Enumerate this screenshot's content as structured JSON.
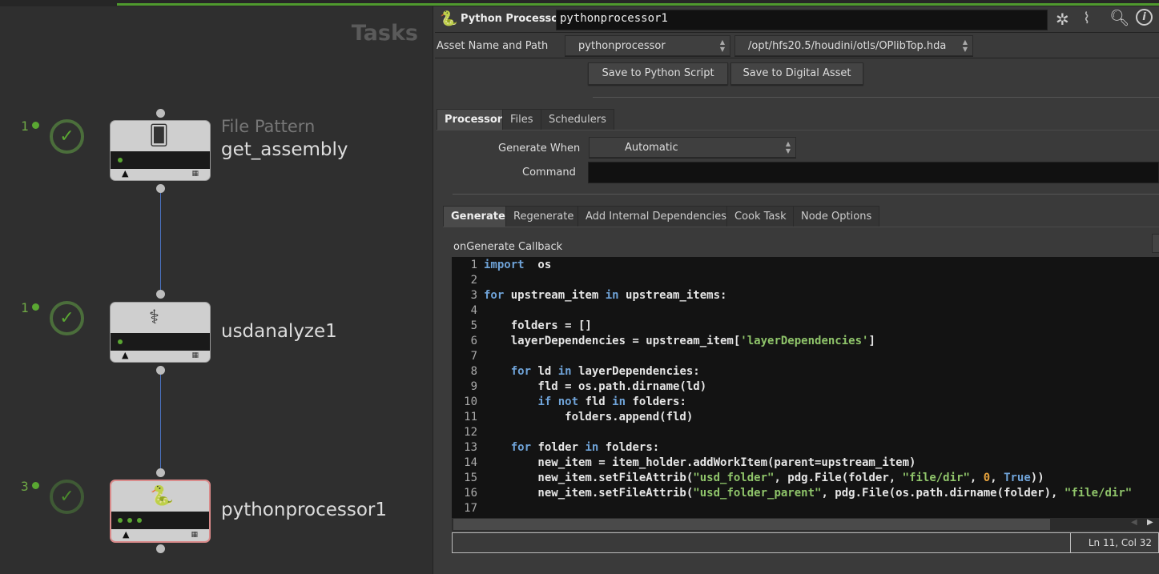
{
  "network": {
    "title": "Tasks",
    "nodes": [
      {
        "type": "File Pattern",
        "name": "get_assembly",
        "count": "1",
        "icon": "file-pattern-icon"
      },
      {
        "type": "",
        "name": "usdanalyze1",
        "count": "1",
        "icon": "usd-analyze-icon"
      },
      {
        "type": "",
        "name": "pythonprocessor1",
        "count": "3",
        "icon": "python-icon"
      }
    ]
  },
  "header": {
    "node_type": "Python Processor",
    "node_name": "pythonprocessor1",
    "icons": [
      "gear-icon",
      "brush-icon",
      "search-icon",
      "info-icon"
    ]
  },
  "asset": {
    "label": "Asset Name and Path",
    "name": "pythonprocessor",
    "path": "/opt/hfs20.5/houdini/otls/OPlibTop.hda",
    "save_script": "Save to Python Script",
    "save_asset": "Save to Digital Asset"
  },
  "tabs": [
    "Processor",
    "Files",
    "Schedulers"
  ],
  "params": {
    "generate_when_label": "Generate When",
    "generate_when": "Automatic",
    "command_label": "Command",
    "command": ""
  },
  "subtabs": [
    "Generate",
    "Regenerate",
    "Add Internal Dependencies",
    "Cook Task",
    "Node Options"
  ],
  "callback_label": "onGenerate Callback",
  "code": [
    [
      [
        "kw",
        "import"
      ],
      [
        "",
        "  os"
      ]
    ],
    [],
    [
      [
        "kw",
        "for"
      ],
      [
        "",
        " upstream_item "
      ],
      [
        "kw",
        "in"
      ],
      [
        "",
        " upstream_items:"
      ]
    ],
    [],
    [
      [
        "",
        "    folders = []"
      ]
    ],
    [
      [
        "",
        "    layerDependencies = upstream_item["
      ],
      [
        "st",
        "'layerDependencies'"
      ],
      [
        "",
        "]"
      ]
    ],
    [],
    [
      [
        "",
        "    "
      ],
      [
        "kw",
        "for"
      ],
      [
        "",
        " ld "
      ],
      [
        "kw",
        "in"
      ],
      [
        "",
        " layerDependencies:"
      ]
    ],
    [
      [
        "",
        "        fld = os.path.dirname(ld)"
      ]
    ],
    [
      [
        "",
        "        "
      ],
      [
        "kw",
        "if not"
      ],
      [
        "",
        " fld "
      ],
      [
        "kw",
        "in"
      ],
      [
        "",
        " folders:"
      ]
    ],
    [
      [
        "",
        "            folders.append(fld)"
      ]
    ],
    [],
    [
      [
        "",
        "    "
      ],
      [
        "kw",
        "for"
      ],
      [
        "",
        " folder "
      ],
      [
        "kw",
        "in"
      ],
      [
        "",
        " folders:"
      ]
    ],
    [
      [
        "",
        "        new_item = item_holder.addWorkItem(parent=upstream_item)"
      ]
    ],
    [
      [
        "",
        "        new_item.setFileAttrib("
      ],
      [
        "st",
        "\"usd_folder\""
      ],
      [
        "",
        ", pdg.File(folder, "
      ],
      [
        "st",
        "\"file/dir\""
      ],
      [
        "",
        ", "
      ],
      [
        "nu",
        "0"
      ],
      [
        "",
        ", "
      ],
      [
        "kw",
        "True"
      ],
      [
        "",
        "))"
      ]
    ],
    [
      [
        "",
        "        new_item.setFileAttrib("
      ],
      [
        "st",
        "\"usd_folder_parent\""
      ],
      [
        "",
        ", pdg.File(os.path.dirname(folder), "
      ],
      [
        "st",
        "\"file/dir\""
      ]
    ],
    []
  ],
  "status": {
    "cursor": "Ln 11, Col 32"
  }
}
